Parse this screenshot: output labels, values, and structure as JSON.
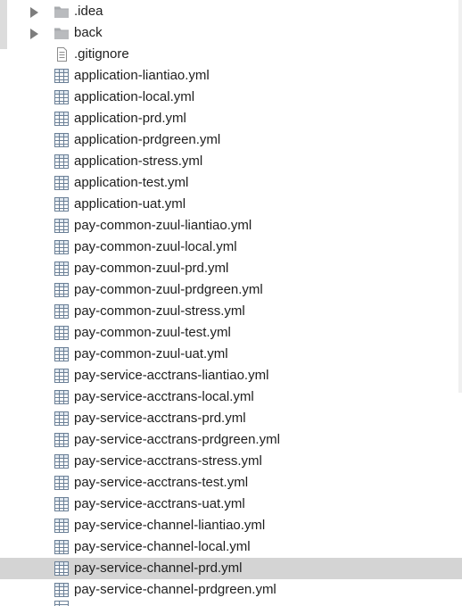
{
  "tree": {
    "items": [
      {
        "label": ".idea",
        "icon": "folder-icon",
        "expandable": true,
        "selected": false
      },
      {
        "label": "back",
        "icon": "folder-icon",
        "expandable": true,
        "selected": false
      },
      {
        "label": ".gitignore",
        "icon": "text-file-icon",
        "expandable": false,
        "selected": false
      },
      {
        "label": "application-liantiao.yml",
        "icon": "yml-file-icon",
        "expandable": false,
        "selected": false
      },
      {
        "label": "application-local.yml",
        "icon": "yml-file-icon",
        "expandable": false,
        "selected": false
      },
      {
        "label": "application-prd.yml",
        "icon": "yml-file-icon",
        "expandable": false,
        "selected": false
      },
      {
        "label": "application-prdgreen.yml",
        "icon": "yml-file-icon",
        "expandable": false,
        "selected": false
      },
      {
        "label": "application-stress.yml",
        "icon": "yml-file-icon",
        "expandable": false,
        "selected": false
      },
      {
        "label": "application-test.yml",
        "icon": "yml-file-icon",
        "expandable": false,
        "selected": false
      },
      {
        "label": "application-uat.yml",
        "icon": "yml-file-icon",
        "expandable": false,
        "selected": false
      },
      {
        "label": "pay-common-zuul-liantiao.yml",
        "icon": "yml-file-icon",
        "expandable": false,
        "selected": false
      },
      {
        "label": "pay-common-zuul-local.yml",
        "icon": "yml-file-icon",
        "expandable": false,
        "selected": false
      },
      {
        "label": "pay-common-zuul-prd.yml",
        "icon": "yml-file-icon",
        "expandable": false,
        "selected": false
      },
      {
        "label": "pay-common-zuul-prdgreen.yml",
        "icon": "yml-file-icon",
        "expandable": false,
        "selected": false
      },
      {
        "label": "pay-common-zuul-stress.yml",
        "icon": "yml-file-icon",
        "expandable": false,
        "selected": false
      },
      {
        "label": "pay-common-zuul-test.yml",
        "icon": "yml-file-icon",
        "expandable": false,
        "selected": false
      },
      {
        "label": "pay-common-zuul-uat.yml",
        "icon": "yml-file-icon",
        "expandable": false,
        "selected": false
      },
      {
        "label": "pay-service-acctrans-liantiao.yml",
        "icon": "yml-file-icon",
        "expandable": false,
        "selected": false
      },
      {
        "label": "pay-service-acctrans-local.yml",
        "icon": "yml-file-icon",
        "expandable": false,
        "selected": false
      },
      {
        "label": "pay-service-acctrans-prd.yml",
        "icon": "yml-file-icon",
        "expandable": false,
        "selected": false
      },
      {
        "label": "pay-service-acctrans-prdgreen.yml",
        "icon": "yml-file-icon",
        "expandable": false,
        "selected": false
      },
      {
        "label": "pay-service-acctrans-stress.yml",
        "icon": "yml-file-icon",
        "expandable": false,
        "selected": false
      },
      {
        "label": "pay-service-acctrans-test.yml",
        "icon": "yml-file-icon",
        "expandable": false,
        "selected": false
      },
      {
        "label": "pay-service-acctrans-uat.yml",
        "icon": "yml-file-icon",
        "expandable": false,
        "selected": false
      },
      {
        "label": "pay-service-channel-liantiao.yml",
        "icon": "yml-file-icon",
        "expandable": false,
        "selected": false
      },
      {
        "label": "pay-service-channel-local.yml",
        "icon": "yml-file-icon",
        "expandable": false,
        "selected": false
      },
      {
        "label": "pay-service-channel-prd.yml",
        "icon": "yml-file-icon",
        "expandable": false,
        "selected": true
      },
      {
        "label": "pay-service-channel-prdgreen.yml",
        "icon": "yml-file-icon",
        "expandable": false,
        "selected": false
      }
    ]
  },
  "colors": {
    "background": "#ffffff",
    "selected_row": "#d4d4d4",
    "text": "#1e1e1e",
    "folder": "#a7aaad",
    "arrow": "#7d7d7d",
    "yml_icon_stroke": "#6a7f96"
  }
}
